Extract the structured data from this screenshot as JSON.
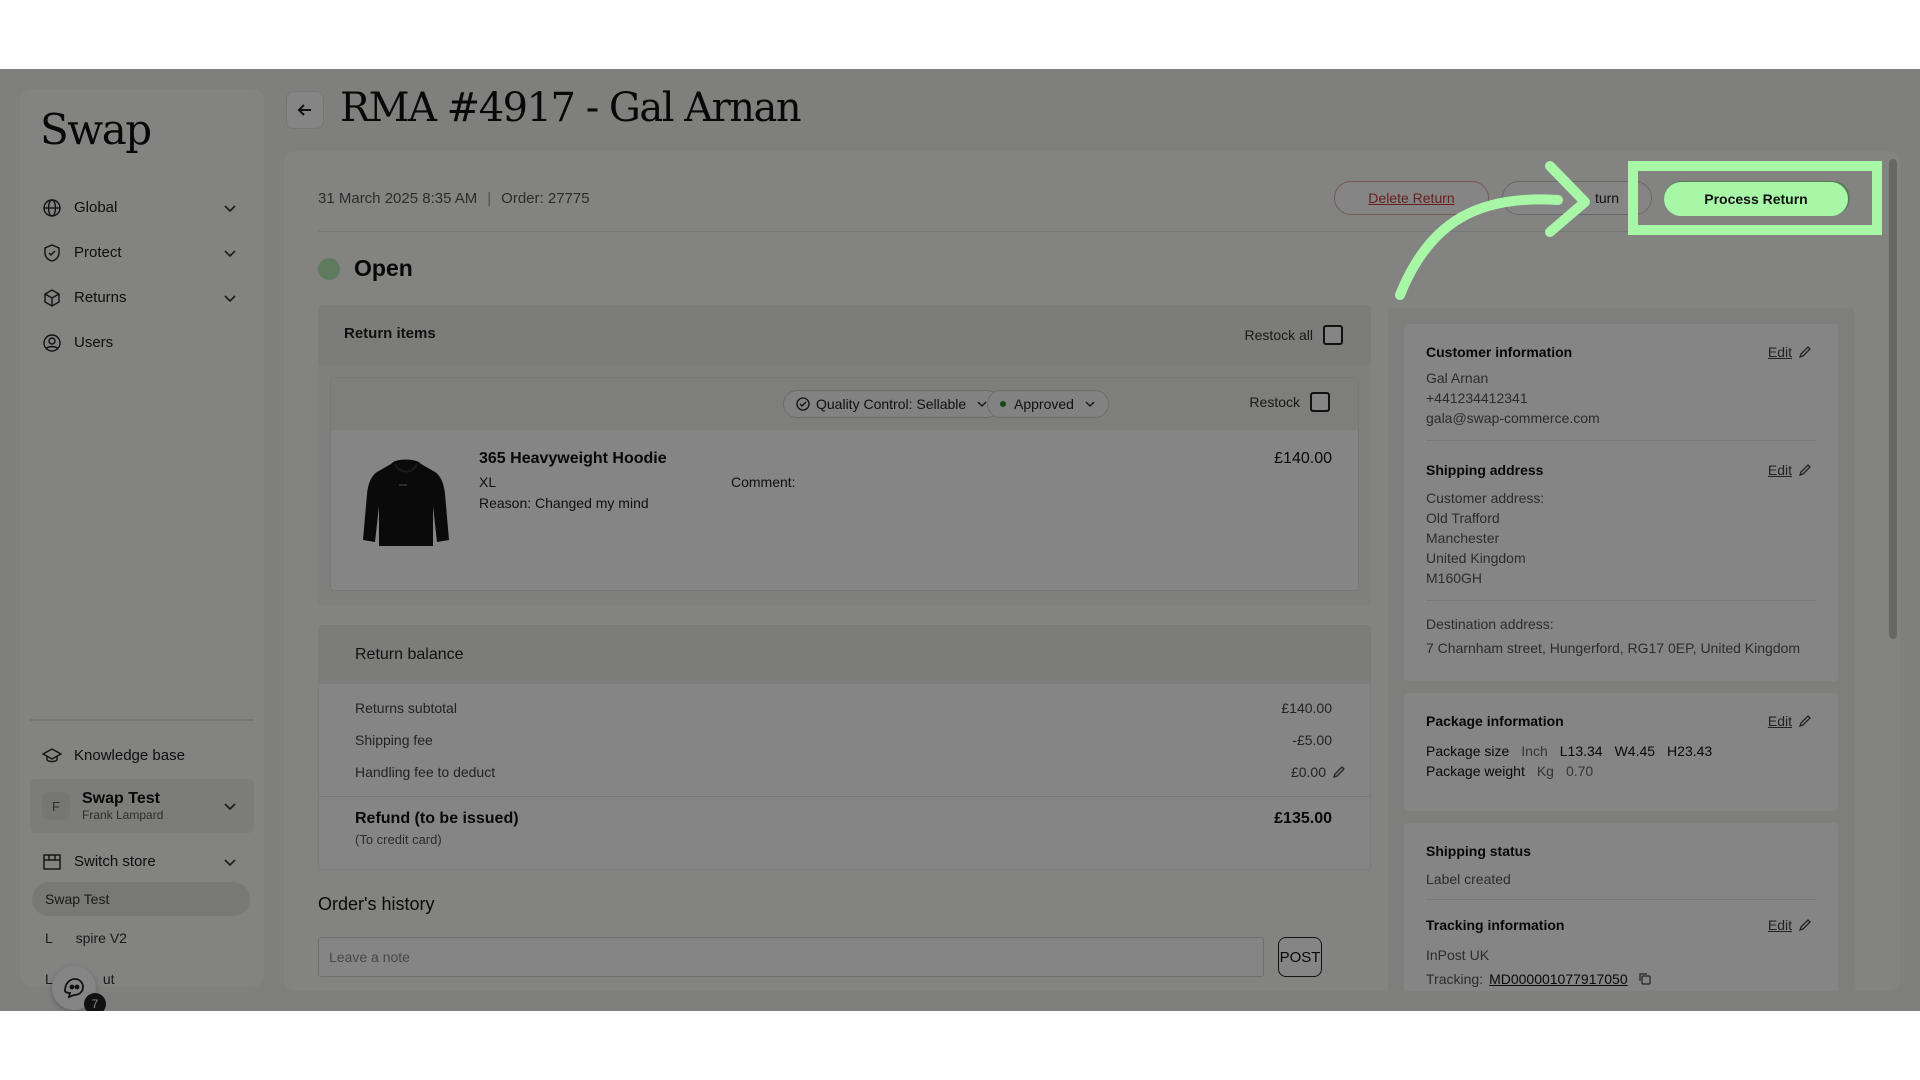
{
  "app": {
    "logo": "Swap",
    "page_title": "RMA #4917 - Gal Arnan"
  },
  "sidebar": {
    "items": [
      {
        "label": "Global",
        "icon": "globe-icon"
      },
      {
        "label": "Protect",
        "icon": "shield-icon"
      },
      {
        "label": "Returns",
        "icon": "box-icon"
      },
      {
        "label": "Users",
        "icon": "user-circle-icon"
      }
    ],
    "knowledge_base": "Knowledge base",
    "account": {
      "initial": "F",
      "name": "Swap Test",
      "user": "Frank Lampard"
    },
    "switch_store": "Switch store",
    "stores": [
      "Swap Test",
      "L      spire V2",
      "L             ut"
    ],
    "help_badge": "7"
  },
  "return": {
    "date": "31 March 2025 8:35 AM",
    "order": "Order: 27775",
    "delete_label": "Delete Return",
    "reject_label": "turn",
    "process_label": "Process Return",
    "status": "Open",
    "status_color": "#b6eab6"
  },
  "items": {
    "title": "Return items",
    "restock_all_label": "Restock all",
    "list": [
      {
        "quality_label": "Quality Control: Sellable",
        "approval_label": "Approved",
        "restock_label": "Restock",
        "name": "365 Heavyweight Hoodie",
        "size": "XL",
        "reason": "Reason: Changed my mind",
        "comment": "Comment:",
        "price": "£140.00"
      }
    ]
  },
  "balance": {
    "title": "Return balance",
    "rows": [
      {
        "label": "Returns subtotal",
        "value": "£140.00"
      },
      {
        "label": "Shipping fee",
        "value": "-£5.00"
      },
      {
        "label": "Handling fee to deduct",
        "value": "£0.00"
      }
    ],
    "refund_label": "Refund (to be issued)",
    "refund_sub": "(To credit card)",
    "refund_amount": "£135.00"
  },
  "history": {
    "title": "Order's history",
    "note_placeholder": "Leave a note",
    "post_label": "POST"
  },
  "customer": {
    "title": "Customer information",
    "edit_label": "Edit",
    "name": "Gal Arnan",
    "phone": "+441234412341",
    "email": "gala@swap-commerce.com"
  },
  "shipping_address": {
    "title": "Shipping address",
    "edit_label": "Edit",
    "customer_address_label": "Customer address:",
    "lines": [
      "Old Trafford",
      "Manchester",
      "United Kingdom",
      "M160GH"
    ],
    "destination_label": "Destination address:",
    "destination": "7 Charnham street, Hungerford, RG17 0EP, United Kingdom"
  },
  "package": {
    "title": "Package information",
    "edit_label": "Edit",
    "size_label": "Package size",
    "size_unit": "Inch",
    "length": "L13.34",
    "width": "W4.45",
    "height": "H23.43",
    "weight_label": "Package weight",
    "weight_unit": "Kg",
    "weight_value": "0.70"
  },
  "shipping_status": {
    "title": "Shipping status",
    "value": "Label created"
  },
  "tracking": {
    "title": "Tracking information",
    "edit_label": "Edit",
    "carrier": "InPost UK",
    "tracking_label": "Tracking:",
    "tracking_number": "MD000001077917050"
  },
  "colors": {
    "accent_green": "#a7f7a7",
    "danger": "#c73c3c"
  }
}
